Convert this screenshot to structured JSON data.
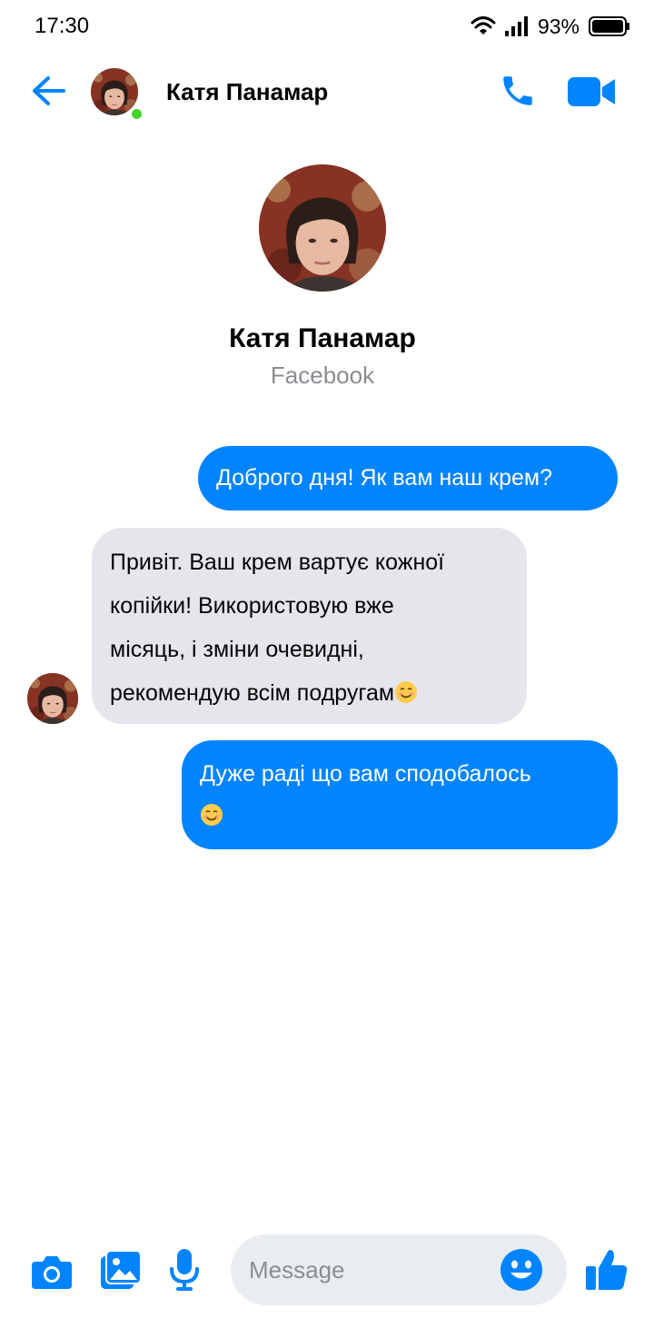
{
  "status_bar": {
    "time": "17:30",
    "battery_percent": "93%",
    "icons": [
      "wifi-icon",
      "cellular-signal-icon",
      "battery-icon"
    ]
  },
  "header": {
    "contact_name": "Катя Панамар",
    "online": true,
    "icons": [
      "back-arrow-icon",
      "phone-icon",
      "video-camera-icon"
    ]
  },
  "profile": {
    "name": "Катя Панамар",
    "source": "Facebook"
  },
  "messages": [
    {
      "direction": "outgoing",
      "text": "Доброго дня! Як вам наш крем?"
    },
    {
      "direction": "incoming",
      "lines": [
        "Привіт. Ваш крем вартує кожної",
        "копійки! Використовую вже",
        "місяць, і зміни очевидні,",
        "рекомендую всім подругам"
      ],
      "emoji": "smiling-face-emoji"
    },
    {
      "direction": "outgoing",
      "text": "Дуже раді що вам сподобалось",
      "emoji": "smiling-face-emoji"
    }
  ],
  "composer": {
    "placeholder": "Message",
    "icons": [
      "camera-icon",
      "gallery-icon",
      "microphone-icon",
      "smiley-icon",
      "thumbs-up-icon"
    ]
  },
  "colors": {
    "accent": "#0084ff",
    "incoming_bubble": "#e4e6eb",
    "online_dot": "#44d62c",
    "secondary_text": "#8a8d91"
  }
}
